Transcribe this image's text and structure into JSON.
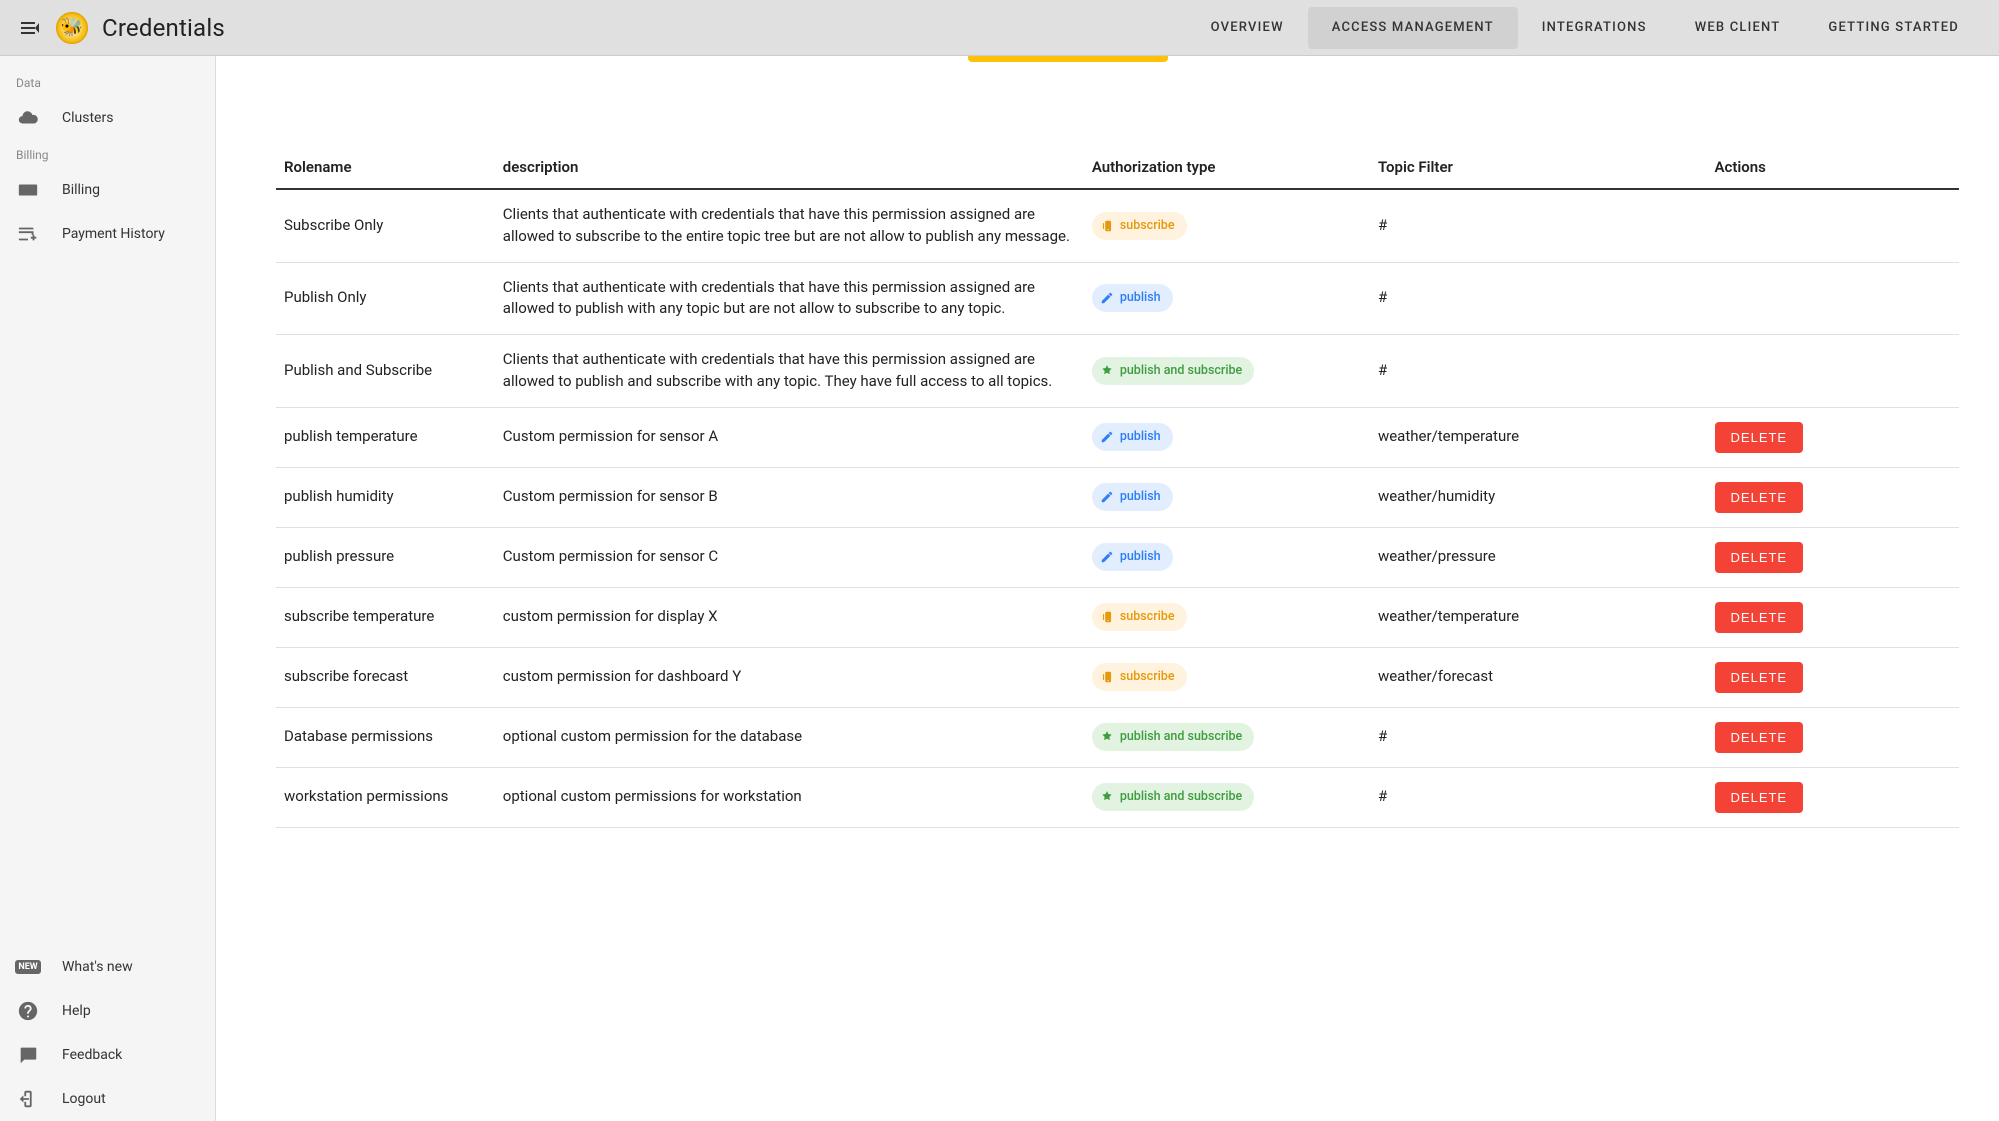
{
  "header": {
    "title": "Credentials",
    "tabs": [
      {
        "label": "Overview",
        "active": false
      },
      {
        "label": "Access Management",
        "active": true
      },
      {
        "label": "Integrations",
        "active": false
      },
      {
        "label": "Web Client",
        "active": false
      },
      {
        "label": "Getting Started",
        "active": false
      }
    ]
  },
  "sidebar": {
    "sections": [
      {
        "label": "Data",
        "items": [
          {
            "label": "Clusters",
            "icon": "cloud"
          }
        ]
      },
      {
        "label": "Billing",
        "items": [
          {
            "label": "Billing",
            "icon": "card"
          },
          {
            "label": "Payment History",
            "icon": "card-plus"
          }
        ]
      }
    ],
    "footer": [
      {
        "label": "What's new",
        "icon": "new"
      },
      {
        "label": "Help",
        "icon": "help"
      },
      {
        "label": "Feedback",
        "icon": "feedback"
      },
      {
        "label": "Logout",
        "icon": "logout"
      }
    ]
  },
  "table": {
    "columns": {
      "role": "Rolename",
      "desc": "description",
      "auth": "Authorization type",
      "topic": "Topic Filter",
      "actions": "Actions"
    },
    "deleteLabel": "DELETE",
    "chipLabels": {
      "subscribe": "subscribe",
      "publish": "publish",
      "both": "publish and subscribe"
    },
    "rows": [
      {
        "role": "Subscribe Only",
        "desc": "Clients that authenticate with credentials that have this permission assigned are allowed to subscribe to the entire topic tree but are not allow to publish any message.",
        "auth": "subscribe",
        "topic": "#",
        "deletable": false
      },
      {
        "role": "Publish Only",
        "desc": "Clients that authenticate with credentials that have this permission assigned are allowed to publish with any topic but are not allow to subscribe to any topic.",
        "auth": "publish",
        "topic": "#",
        "deletable": false
      },
      {
        "role": "Publish and Subscribe",
        "desc": "Clients that authenticate with credentials that have this permission assigned are allowed to publish and subscribe with any topic. They have full access to all topics.",
        "auth": "both",
        "topic": "#",
        "deletable": false
      },
      {
        "role": "publish temperature",
        "desc": "Custom permission for sensor A",
        "auth": "publish",
        "topic": "weather/temperature",
        "deletable": true
      },
      {
        "role": "publish humidity",
        "desc": "Custom permission for sensor B",
        "auth": "publish",
        "topic": "weather/humidity",
        "deletable": true
      },
      {
        "role": "publish pressure",
        "desc": "Custom permission for sensor C",
        "auth": "publish",
        "topic": "weather/pressure",
        "deletable": true
      },
      {
        "role": "subscribe temperature",
        "desc": "custom permission for display X",
        "auth": "subscribe",
        "topic": "weather/temperature",
        "deletable": true
      },
      {
        "role": "subscribe forecast",
        "desc": "custom permission for dashboard Y",
        "auth": "subscribe",
        "topic": "weather/forecast",
        "deletable": true
      },
      {
        "role": "Database permissions",
        "desc": "optional custom permission for the database",
        "auth": "both",
        "topic": "#",
        "deletable": true
      },
      {
        "role": "workstation permissions",
        "desc": "optional custom permissions for workstation",
        "auth": "both",
        "topic": "#",
        "deletable": true
      }
    ]
  }
}
